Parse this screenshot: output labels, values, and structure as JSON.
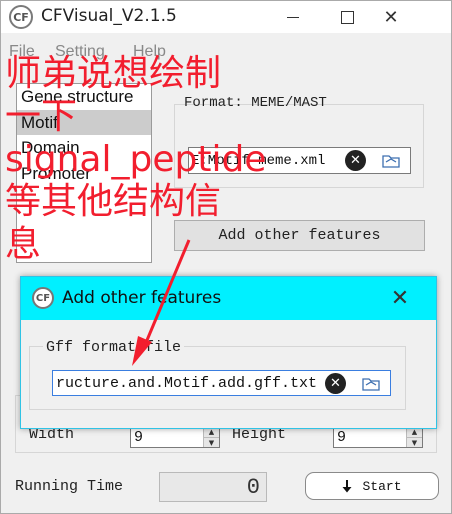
{
  "window": {
    "title": "CFVisual_V2.1.5",
    "icon_text": "CF",
    "controls": {
      "close_glyph": "✕"
    }
  },
  "menu": {
    "file": "File",
    "setting": "Setting",
    "help": "Help"
  },
  "list": {
    "items": [
      "Gene structure",
      "Motif",
      "Domain",
      "Promoter"
    ],
    "selected_index": 1
  },
  "format": {
    "label": "Format: MEME/MAST",
    "file_value": "E:Motif meme.xml"
  },
  "add_button": "Add other features",
  "size": {
    "width_label": "Width",
    "width_value": "9",
    "height_label": "Height",
    "height_value": "9"
  },
  "running": {
    "label": "Running Time",
    "value": "0"
  },
  "start_button": "Start",
  "dialog": {
    "title": "Add other features",
    "icon_text": "CF",
    "close_glyph": "✕",
    "group_label": "Gff format file",
    "file_value": "ructure.and.Motif.add.gff.txt"
  },
  "annotation": {
    "lines": [
      "师弟说想绘制",
      "一下",
      "signal_peptide",
      "等其他结构信",
      "息"
    ],
    "color": "#f21e2e"
  },
  "icons": {
    "clear": "clear-icon",
    "folder": "folder-icon",
    "arrow": "arrow-down-icon"
  }
}
